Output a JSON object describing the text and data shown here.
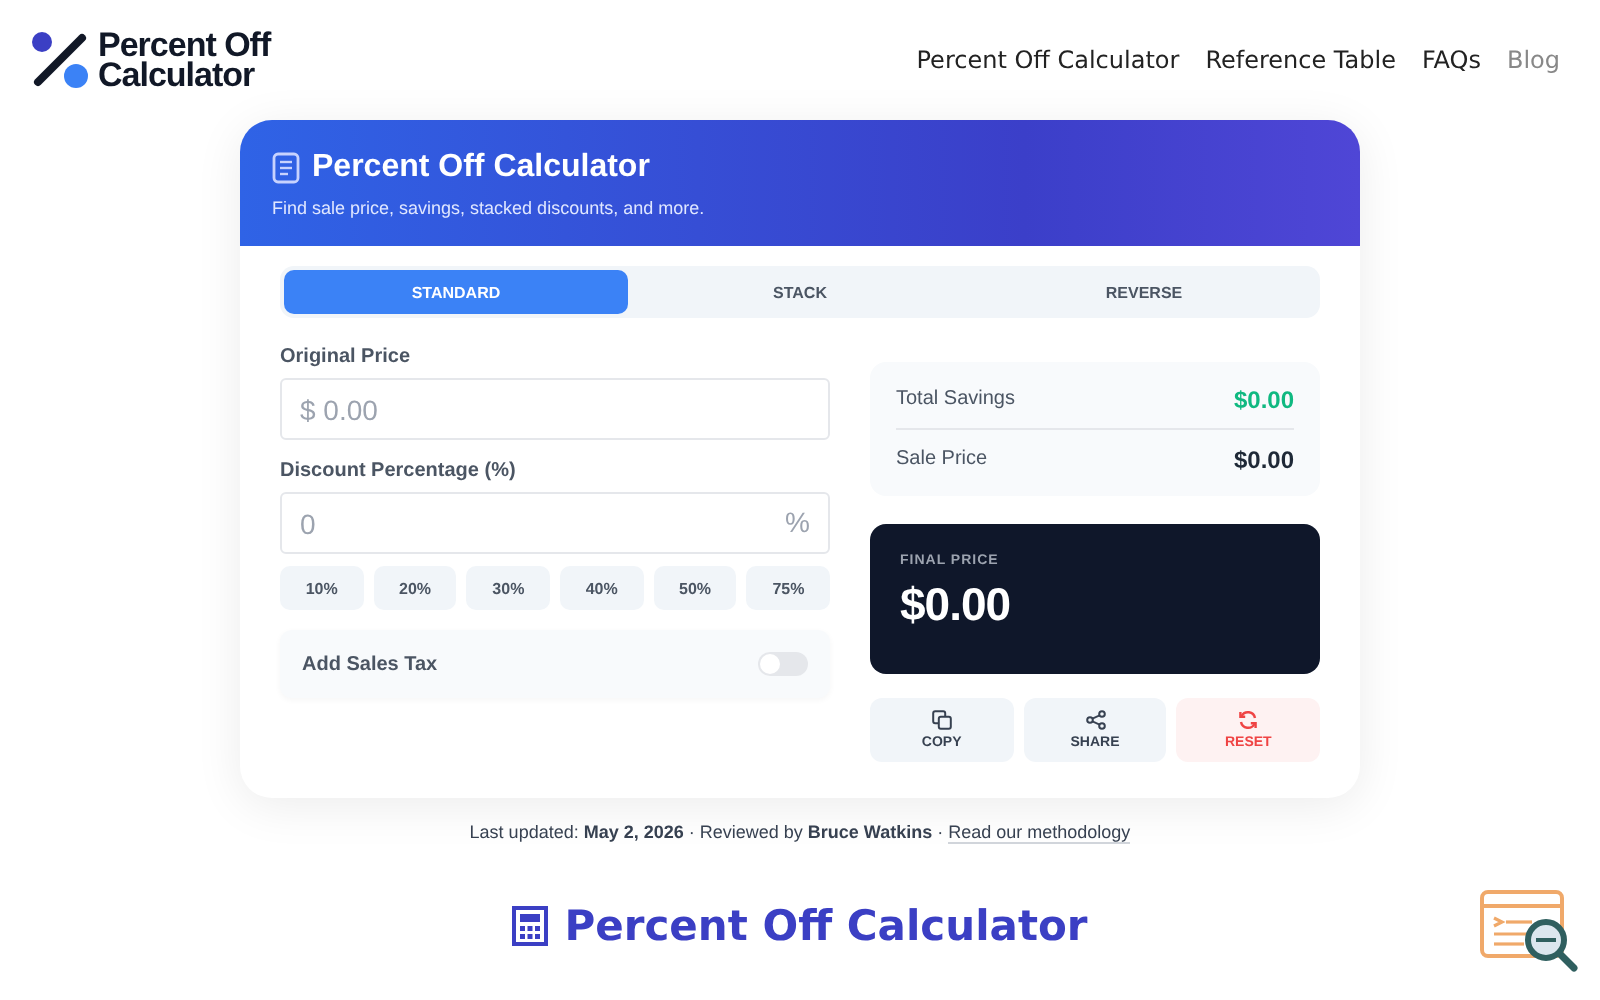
{
  "logo": {
    "line_1": "Percent Off",
    "line_2": "Calculator"
  },
  "nav": [
    {
      "label": "Percent Off Calculator",
      "muted": false
    },
    {
      "label": "Reference Table",
      "muted": false
    },
    {
      "label": "FAQs",
      "muted": false
    },
    {
      "label": "Blog",
      "muted": true
    }
  ],
  "card": {
    "title": "Percent Off Calculator",
    "subtitle": "Find sale price, savings, stacked discounts, and more."
  },
  "tabs": [
    {
      "label": "STANDARD",
      "selected": true
    },
    {
      "label": "STACK",
      "selected": false
    },
    {
      "label": "REVERSE",
      "selected": false
    }
  ],
  "original_price": {
    "label": "Original Price",
    "placeholder": "$ 0.00"
  },
  "discount": {
    "label": "Discount Percentage (%)",
    "placeholder": "0",
    "suffix": "%"
  },
  "presets": [
    "10%",
    "20%",
    "30%",
    "40%",
    "50%",
    "75%"
  ],
  "sales_tax": {
    "label": "Add Sales Tax",
    "on": false
  },
  "summary": [
    {
      "label": "Total Savings",
      "value": "$0.00",
      "color": "#10b981"
    },
    {
      "label": "Sale Price",
      "value": "$0.00",
      "color": "#1f2937"
    }
  ],
  "final_price": {
    "label": "FINAL PRICE",
    "value": "$0.00"
  },
  "actions": [
    {
      "kind": "copy",
      "label": "COPY"
    },
    {
      "kind": "share",
      "label": "SHARE"
    },
    {
      "kind": "reset",
      "label": "RESET"
    }
  ],
  "meta": {
    "text": "Last updated: **May 2, 2026** · Reviewed by **Bruce Watkins** ·",
    "link": "Read our methodology"
  },
  "heading": "Percent Off Calculator"
}
